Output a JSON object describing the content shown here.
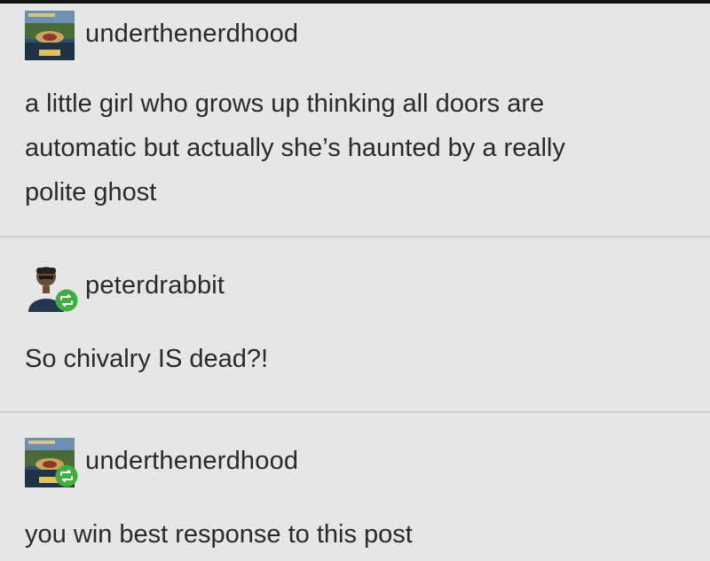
{
  "posts": [
    {
      "username": "underthenerdhood",
      "text_lines": [
        "a little girl who grows up thinking all doors are",
        "automatic but actually she’s haunted by a really",
        "polite ghost"
      ],
      "avatar_icon": "book-cover-avatar",
      "reblog_badge": false
    },
    {
      "username": "peterdrabbit",
      "text_lines": [
        "So chivalry IS dead?!"
      ],
      "avatar_icon": "person-avatar",
      "reblog_badge": true
    },
    {
      "username": "underthenerdhood",
      "text_lines": [
        "you win best response to this post"
      ],
      "avatar_icon": "book-cover-avatar",
      "reblog_badge": true
    }
  ],
  "colors": {
    "background": "#e6e6e6",
    "text": "#2a2a2a",
    "divider": "#cfcfcf",
    "reblog_green": "#3fae3f"
  }
}
